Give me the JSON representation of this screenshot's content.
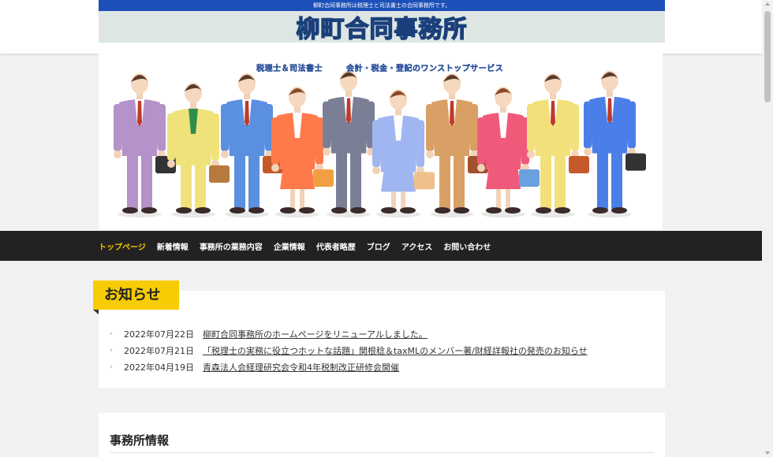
{
  "header": {
    "tagline": "柳町合同事務所は税理士と司法書士の合同事務所です。",
    "logo_text": "柳町合同事務所"
  },
  "hero": {
    "caption_left": "税理士＆司法書士",
    "caption_right": "会計・税金・登記のワンストップサービス",
    "image_description_icon": "business-people-illustration"
  },
  "nav": {
    "items": [
      {
        "label": "トップページ",
        "active": true
      },
      {
        "label": "新着情報"
      },
      {
        "label": "事務所の業務内容"
      },
      {
        "label": "企業情報"
      },
      {
        "label": "代表者略歴"
      },
      {
        "label": "ブログ"
      },
      {
        "label": "アクセス"
      },
      {
        "label": "お問い合わせ"
      }
    ]
  },
  "news": {
    "heading": "お知らせ",
    "items": [
      {
        "date": "2022年07月22日",
        "title": "柳町合同事務所のホームページをリニューアルしました。"
      },
      {
        "date": "2022年07月21日",
        "title": "「税理士の実務に役立つホットな話題」関根稔＆taxMLのメンバー著/財経詳報社の発売のお知らせ"
      },
      {
        "date": "2022年04月19日",
        "title": "青森法人会経理研究会令和4年税制改正研修会開催"
      }
    ]
  },
  "office_info": {
    "heading": "事務所情報"
  },
  "colors": {
    "accent": "#f7cc00",
    "nav_bg": "#222222",
    "tagline_bg": "#1d4fb8",
    "nav_active": "#f2c200"
  }
}
